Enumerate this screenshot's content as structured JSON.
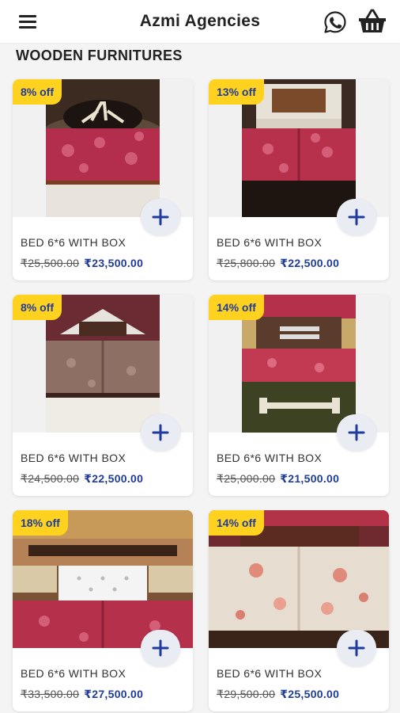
{
  "header": {
    "title": "Azmi Agencies",
    "menu_icon": "hamburger-menu-icon",
    "whatsapp_icon": "whatsapp-icon",
    "cart_icon": "shopping-basket-icon"
  },
  "section": {
    "title": "WOODEN FURNITURES"
  },
  "colors": {
    "accent": "#1f3c9c",
    "badge": "#ffd21f",
    "add_button_bg": "#e9ecf3"
  },
  "products": [
    {
      "discount": "8% off",
      "name": "BED 6*6 WITH BOX",
      "old_price": "₹25,500.00",
      "new_price": "₹23,500.00"
    },
    {
      "discount": "13% off",
      "name": "BED 6*6 WITH BOX",
      "old_price": "₹25,800.00",
      "new_price": "₹22,500.00"
    },
    {
      "discount": "8% off",
      "name": "BED 6*6 WITH BOX",
      "old_price": "₹24,500.00",
      "new_price": "₹22,500.00"
    },
    {
      "discount": "14% off",
      "name": "BED 6*6 WITH BOX",
      "old_price": "₹25,000.00",
      "new_price": "₹21,500.00"
    },
    {
      "discount": "18% off",
      "name": "BED 6*6 WITH BOX",
      "old_price": "₹33,500.00",
      "new_price": "₹27,500.00"
    },
    {
      "discount": "14% off",
      "name": "BED 6*6 WITH BOX",
      "old_price": "₹29,500.00",
      "new_price": "₹25,500.00"
    }
  ]
}
